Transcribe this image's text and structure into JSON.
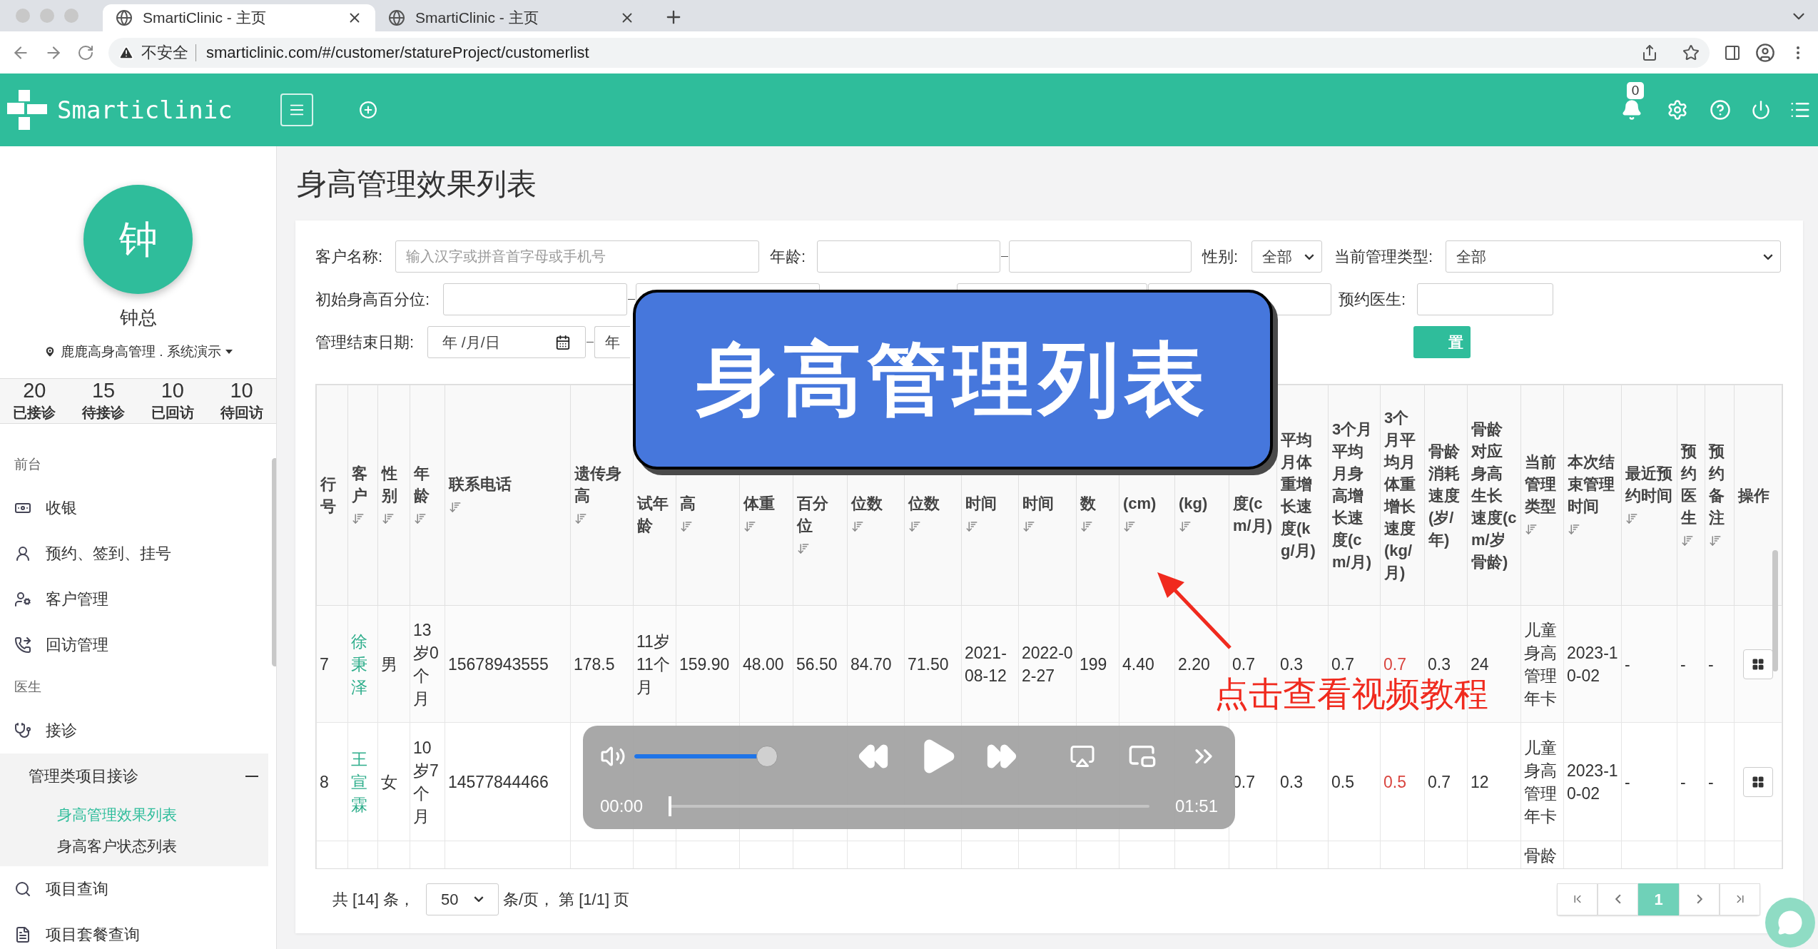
{
  "browser": {
    "tabs": [
      {
        "title": "SmartiClinic - 主页",
        "selected": true
      },
      {
        "title": "SmartiClinic - 主页",
        "selected": false
      }
    ],
    "security": "不安全",
    "url": "smarticlinic.com/#/customer/statureProject/customerlist"
  },
  "header": {
    "brand": "Smarticlinic",
    "notifications": "0"
  },
  "sidebar": {
    "avatar": "钟",
    "user": "钟总",
    "location": "鹿鹿高身高管理 . 系统演示",
    "stats": [
      {
        "value": "20",
        "label": "已接诊"
      },
      {
        "value": "15",
        "label": "待接诊"
      },
      {
        "value": "10",
        "label": "已回访"
      },
      {
        "value": "10",
        "label": "待回访"
      }
    ],
    "menu": [
      {
        "kind": "section",
        "label": "前台"
      },
      {
        "kind": "item",
        "label": "收银"
      },
      {
        "kind": "item",
        "label": "预约、签到、挂号"
      },
      {
        "kind": "item",
        "label": "客户管理"
      },
      {
        "kind": "item",
        "label": "回访管理"
      },
      {
        "kind": "section",
        "label": "医生"
      },
      {
        "kind": "item",
        "label": "接诊"
      },
      {
        "kind": "group",
        "label": "管理类项目接诊",
        "expanded": true,
        "children": [
          {
            "label": "身高管理效果列表",
            "selected": true
          },
          {
            "label": "身高客户状态列表",
            "selected": false
          }
        ]
      },
      {
        "kind": "item",
        "label": "项目查询"
      },
      {
        "kind": "item",
        "label": "项目套餐查询"
      }
    ]
  },
  "page": {
    "title": "身高管理效果列表"
  },
  "filters": {
    "customer": {
      "label": "客户名称:",
      "placeholder": "输入汉字或拼音首字母或手机号"
    },
    "age": {
      "label": "年龄:"
    },
    "gender": {
      "label": "性别:",
      "value": "全部"
    },
    "management_type": {
      "label": "当前管理类型:",
      "value": "全部"
    },
    "initial_percentile": {
      "label": "初始身高百分位:"
    },
    "doctor": {
      "label": "预约医生:"
    },
    "end_date": {
      "label": "管理结束日期:",
      "from": "年 /月/日",
      "to": "年"
    },
    "reset_button": "置"
  },
  "table": {
    "columns": [
      {
        "label": "行号",
        "sortable": false,
        "kind": "text"
      },
      {
        "label": "客户",
        "sortable": true,
        "kind": "link"
      },
      {
        "label": "性别",
        "sortable": true,
        "kind": "text"
      },
      {
        "label": "年龄",
        "sortable": true,
        "kind": "text"
      },
      {
        "label": "联系电话",
        "sortable": true,
        "kind": "text"
      },
      {
        "label": "遗传身高",
        "sortable": true,
        "kind": "text"
      },
      {
        "label": "试年龄",
        "sortable": false,
        "kind": "text"
      },
      {
        "label": "高",
        "sortable": true,
        "kind": "text"
      },
      {
        "label": "体重",
        "sortable": true,
        "kind": "text"
      },
      {
        "label": "百分位",
        "sortable": true,
        "kind": "text"
      },
      {
        "label": "位数",
        "sortable": true,
        "kind": "text"
      },
      {
        "label": "位数",
        "sortable": true,
        "kind": "text"
      },
      {
        "label": "时间",
        "sortable": true,
        "kind": "text"
      },
      {
        "label": "时间",
        "sortable": true,
        "kind": "text"
      },
      {
        "label": "数",
        "sortable": true,
        "kind": "text"
      },
      {
        "label": "(cm)",
        "sortable": true,
        "kind": "text"
      },
      {
        "label": "(kg)",
        "sortable": true,
        "kind": "text"
      },
      {
        "label": "度(cm/月)",
        "sortable": false,
        "kind": "text"
      },
      {
        "label": "平均月体重增长速度(kg/月)",
        "sortable": false,
        "kind": "text"
      },
      {
        "label": "3个月平均月身高增长速度(cm/月)",
        "sortable": false,
        "kind": "text"
      },
      {
        "label": "3个月平均月体重增长速度(kg/月)",
        "sortable": false,
        "kind": "alert"
      },
      {
        "label": "骨龄消耗速度(岁/年)",
        "sortable": false,
        "kind": "text"
      },
      {
        "label": "骨龄对应身高生长速度(cm/岁骨龄)",
        "sortable": false,
        "kind": "text"
      },
      {
        "label": "当前管理类型",
        "sortable": true,
        "kind": "text"
      },
      {
        "label": "本次结束管理时间",
        "sortable": true,
        "kind": "text"
      },
      {
        "label": "最近预约时间",
        "sortable": true,
        "kind": "text"
      },
      {
        "label": "预约医生",
        "sortable": true,
        "kind": "text"
      },
      {
        "label": "预约备注",
        "sortable": true,
        "kind": "text"
      },
      {
        "label": "操作",
        "sortable": false,
        "kind": "action"
      }
    ],
    "rows": [
      {
        "cells": [
          "7",
          "徐秉泽",
          "男",
          "13岁0个月",
          "15678943555",
          "178.5",
          "11岁11个月",
          "159.90",
          "48.00",
          "56.50",
          "84.70",
          "71.50",
          "2021-08-12",
          "2022-02-27",
          "199",
          "4.40",
          "2.20",
          "0.7",
          "0.3",
          "0.7",
          "0.7",
          "0.3",
          "24",
          "儿童身高管理年卡",
          "2023-10-02",
          "-",
          "-",
          "-",
          true
        ]
      },
      {
        "cells": [
          "8",
          "王宣霖",
          "女",
          "10岁7个月",
          "14577844466",
          null,
          null,
          null,
          null,
          null,
          null,
          null,
          null,
          null,
          null,
          null,
          null,
          "0.7",
          "0.3",
          "0.5",
          "0.5",
          "0.7",
          "12",
          "儿童身高管理年卡",
          "2023-10-02",
          "-",
          "-",
          "-",
          true
        ]
      },
      {
        "cells": [
          null,
          null,
          null,
          null,
          null,
          null,
          null,
          null,
          null,
          null,
          null,
          null,
          null,
          null,
          null,
          null,
          null,
          null,
          null,
          null,
          null,
          null,
          null,
          "骨龄",
          null,
          null,
          null,
          null,
          null
        ]
      }
    ]
  },
  "pagination": {
    "total": "共 [14] 条，",
    "page_size": "50",
    "page_info": "条/页， 第 [1/1] 页",
    "pages": [
      {
        "label": "1",
        "selected": true
      }
    ]
  },
  "banner": {
    "title": "身高管理列表",
    "annotation": "点击查看视频教程"
  },
  "player": {
    "volume": {
      "level": 0.93
    },
    "progress": {
      "level": 0
    },
    "current_time": "00:00",
    "duration": "01:51"
  }
}
